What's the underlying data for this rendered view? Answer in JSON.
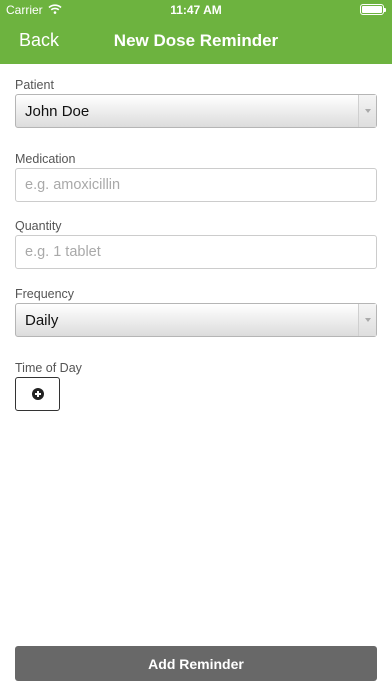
{
  "status_bar": {
    "carrier": "Carrier",
    "time": "11:47 AM",
    "icons": [
      "wifi-icon",
      "battery-icon"
    ]
  },
  "navbar": {
    "back_label": "Back",
    "title": "New Dose Reminder",
    "color": "#6db33f"
  },
  "form": {
    "patient": {
      "label": "Patient",
      "value": "John Doe"
    },
    "medication": {
      "label": "Medication",
      "placeholder": "e.g. amoxicillin",
      "value": ""
    },
    "quantity": {
      "label": "Quantity",
      "placeholder": "e.g. 1 tablet",
      "value": ""
    },
    "frequency": {
      "label": "Frequency",
      "value": "Daily"
    },
    "time_of_day": {
      "label": "Time of Day",
      "add_icon": "plus-circle-icon"
    }
  },
  "submit": {
    "label": "Add Reminder",
    "color": "#686868"
  }
}
